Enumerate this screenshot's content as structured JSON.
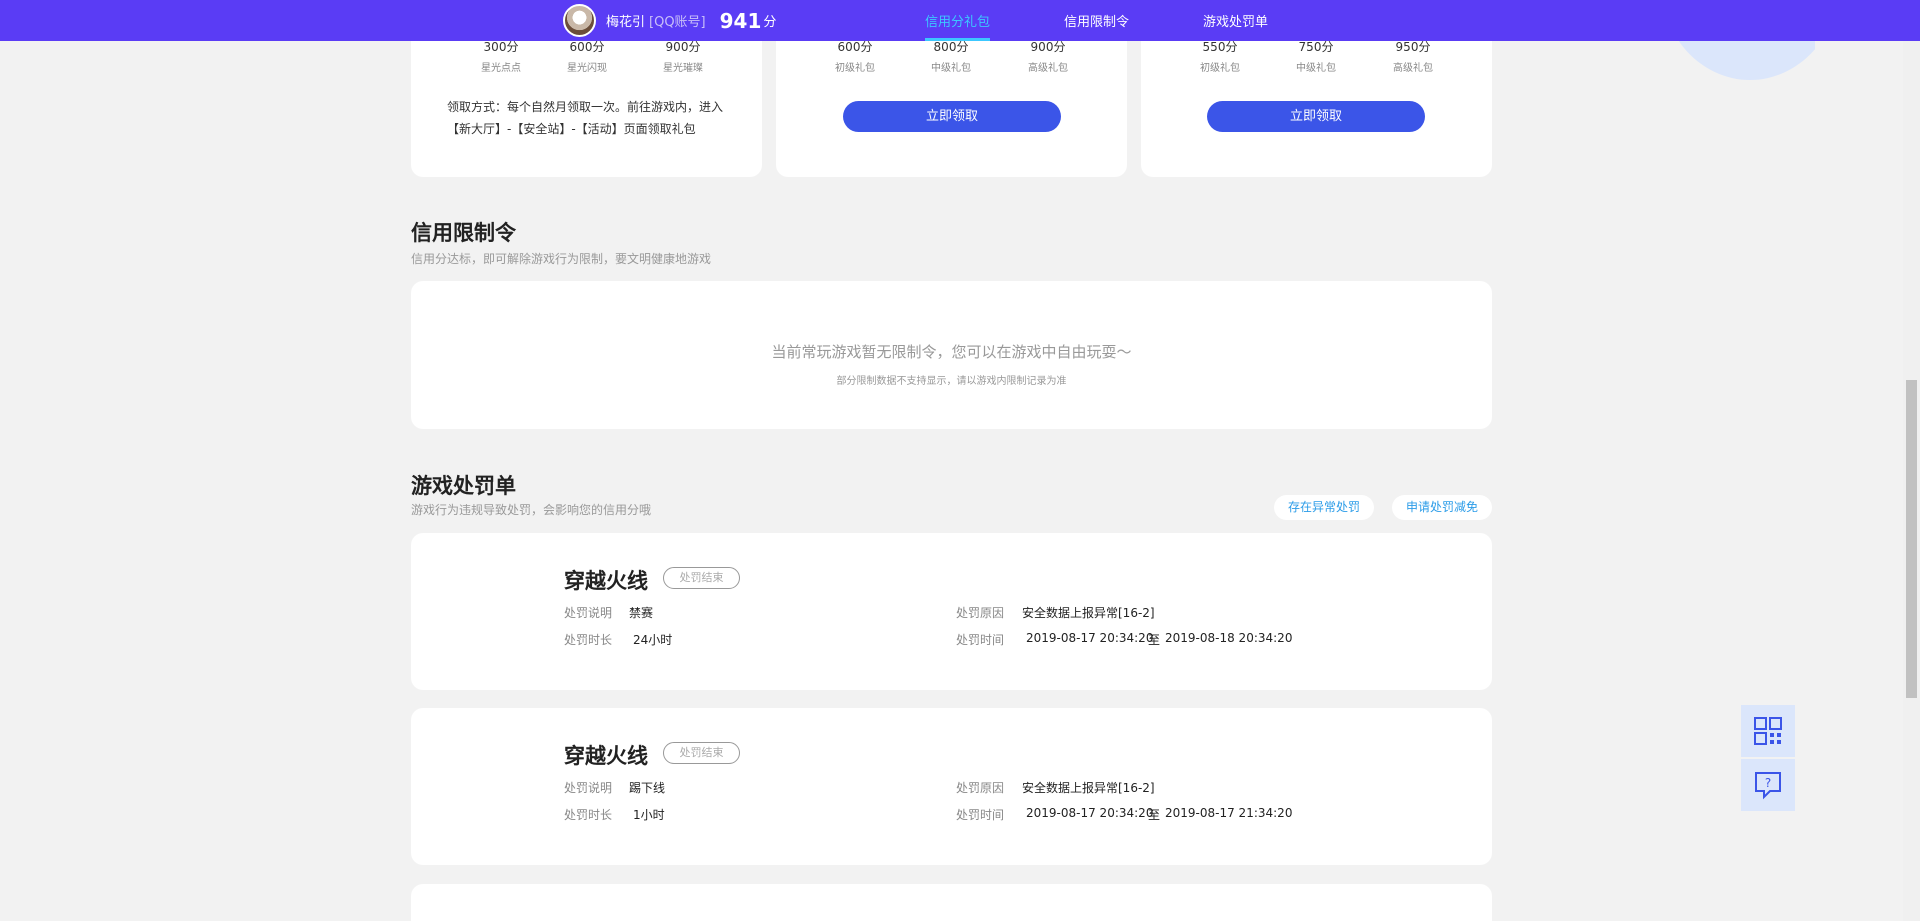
{
  "header": {
    "user_name": "梅花引",
    "account_type": "[QQ账号]",
    "score": "941",
    "score_unit": "分",
    "nav": [
      {
        "label": "信用分礼包",
        "active": true
      },
      {
        "label": "信用限制令",
        "active": false
      },
      {
        "label": "游戏处罚单",
        "active": false
      }
    ]
  },
  "gifts": {
    "card1": {
      "tiers": [
        {
          "points": "300分",
          "name": "星光点点"
        },
        {
          "points": "600分",
          "name": "星光闪现"
        },
        {
          "points": "900分",
          "name": "星光璀璨"
        }
      ],
      "note": "领取方式：每个自然月领取一次。前往游戏内，进入【新大厅】-【安全站】-【活动】页面领取礼包"
    },
    "card2": {
      "tiers": [
        {
          "points": "600分",
          "name": "初级礼包"
        },
        {
          "points": "800分",
          "name": "中级礼包"
        },
        {
          "points": "900分",
          "name": "高级礼包"
        }
      ],
      "button": "立即领取"
    },
    "card3": {
      "tiers": [
        {
          "points": "550分",
          "name": "初级礼包"
        },
        {
          "points": "750分",
          "name": "中级礼包"
        },
        {
          "points": "950分",
          "name": "高级礼包"
        }
      ],
      "button": "立即领取"
    }
  },
  "restriction": {
    "title": "信用限制令",
    "subtitle": "信用分达标，即可解除游戏行为限制，要文明健康地游戏",
    "empty_main": "当前常玩游戏暂无限制令，您可以在游戏中自由玩耍～",
    "empty_sub": "部分限制数据不支持显示，请以游戏内限制记录为准"
  },
  "penalty": {
    "title": "游戏处罚单",
    "subtitle": "游戏行为违规导致处罚，会影响您的信用分哦",
    "btn_abnormal": "存在异常处罚",
    "btn_reduce": "申请处罚减免",
    "labels": {
      "desc": "处罚说明",
      "reason": "处罚原因",
      "duration": "处罚时长",
      "time": "处罚时间"
    },
    "records": [
      {
        "game": "穿越火线",
        "status": "处罚结束",
        "desc": "禁赛",
        "reason": "安全数据上报异常[16-2]",
        "duration": "24小时",
        "time_start": "2019-08-17 20:34:20",
        "time_sep": "至",
        "time_end": "2019-08-18 20:34:20"
      },
      {
        "game": "穿越火线",
        "status": "处罚结束",
        "desc": "踢下线",
        "reason": "安全数据上报异常[16-2]",
        "duration": "1小时",
        "time_start": "2019-08-17 20:34:20",
        "time_sep": "至",
        "time_end": "2019-08-17 21:34:20"
      }
    ]
  }
}
